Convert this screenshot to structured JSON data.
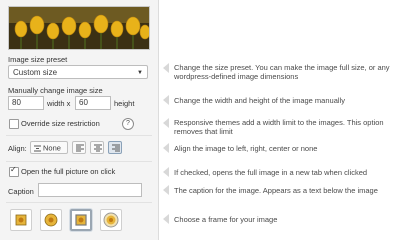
{
  "sidebar": {
    "size_preset_label": "Image size preset",
    "size_preset_value": "Custom size",
    "manual_size_label": "Manually change image size",
    "width_value": "80",
    "width_x_label": "width x",
    "height_value": "60",
    "height_label": "height",
    "override_label": "Override size restriction",
    "help_glyph": "?",
    "align_label": "Align:",
    "align_none_label": "None",
    "open_full_label": "Open the full picture on click",
    "open_full_checked": true,
    "caption_label": "Caption",
    "caption_value": ""
  },
  "descriptions": {
    "size_preset": "Change the size preset. You can make the image full size, or any wordpress-defined image dimensions",
    "manual_size": "Change the width and height of the image manually",
    "override": "Responsive themes add a width limit to the images. This option removes that limit",
    "align": "Align the image to left, right, center or none",
    "open_full": "If checked, opens the full image in a new tab when clicked",
    "caption": "The caption for the image. Appears as a text below the image",
    "frame": "Choose a frame for your image"
  },
  "colors": {
    "panel_bg": "#f4f4f4",
    "accent_selected": "#dfe6ee",
    "pointer": "#d8d8d8"
  }
}
